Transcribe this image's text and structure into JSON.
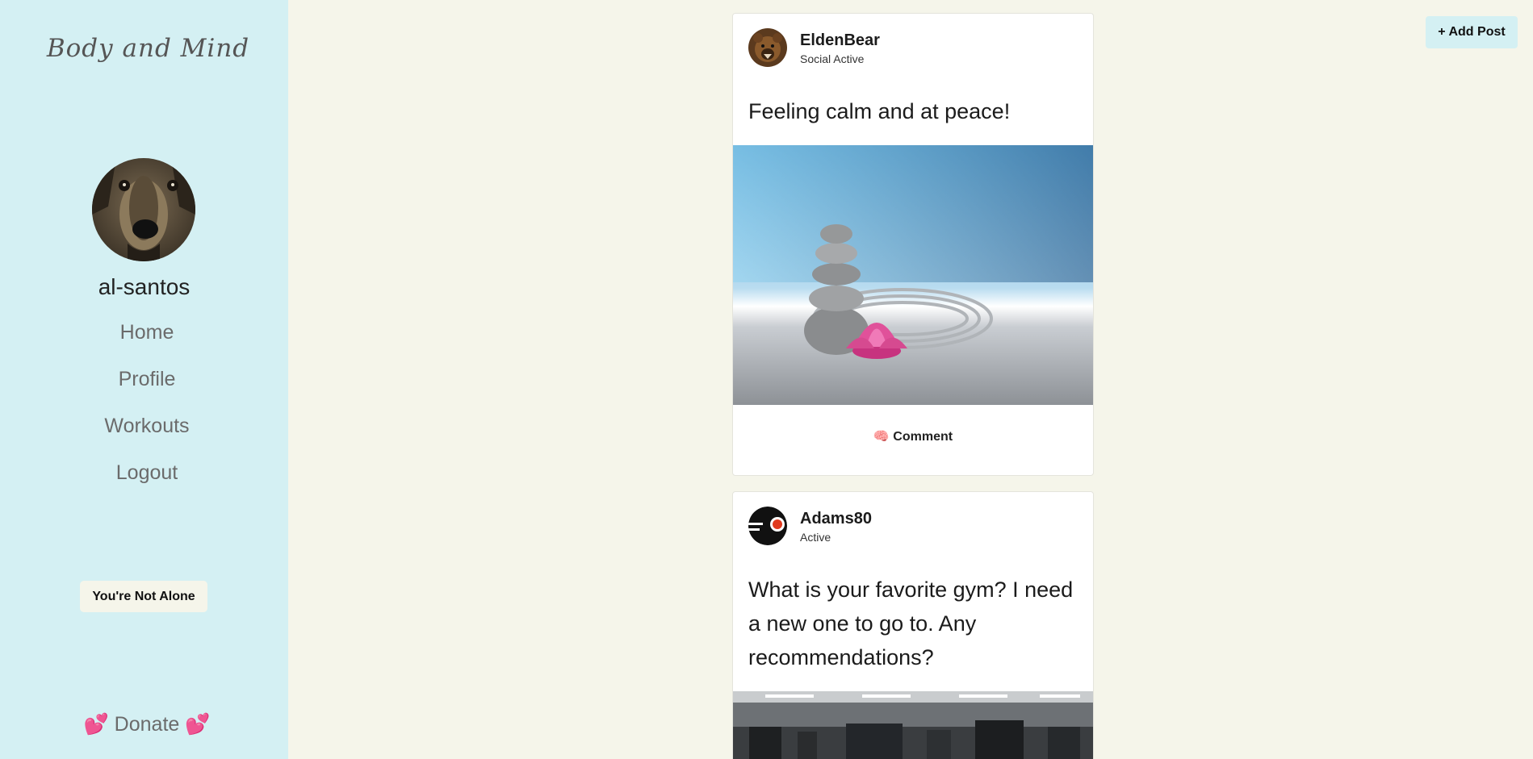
{
  "sidebar": {
    "brand": "Body and Mind",
    "username": "al-santos",
    "nav": [
      "Home",
      "Profile",
      "Workouts",
      "Logout"
    ],
    "alone_button": "You're Not Alone",
    "donate": "💕 Donate 💕"
  },
  "header": {
    "add_post": "+ Add Post"
  },
  "posts": [
    {
      "user": "EldenBear",
      "status": "Social Active",
      "text": "Feeling calm and at peace!",
      "comment": "🧠 Comment"
    },
    {
      "user": "Adams80",
      "status": "Active",
      "text": "What is your favorite gym? I need a new one to go to. Any recommendations?"
    }
  ],
  "colors": {
    "background": "#f5f5ea",
    "sidebar": "#d4f0f3",
    "card": "#ffffff"
  }
}
